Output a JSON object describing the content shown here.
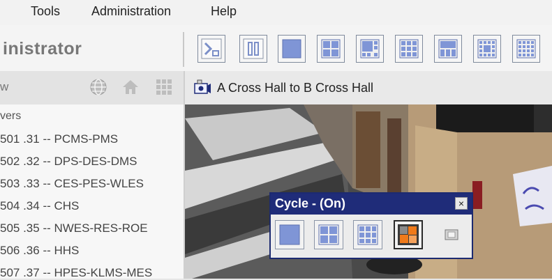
{
  "menu": {
    "items": [
      {
        "label": "Tools"
      },
      {
        "label": "Administration"
      },
      {
        "label": "Help"
      }
    ]
  },
  "app": {
    "title": "inistrator"
  },
  "toolbar": {
    "layout_buttons": [
      {
        "icon": "sequence-icon"
      },
      {
        "icon": "pause-icon"
      },
      {
        "icon": "layout-1x1-icon"
      },
      {
        "icon": "layout-2x2-icon"
      },
      {
        "icon": "layout-1plus5-icon"
      },
      {
        "icon": "layout-3x3-icon"
      },
      {
        "icon": "layout-3x3-alt-icon"
      },
      {
        "icon": "layout-4x4-icon"
      },
      {
        "icon": "layout-4x4-alt-icon"
      }
    ]
  },
  "left_panel": {
    "nav_label": "w",
    "tree_header": "vers",
    "servers": [
      {
        "label": "501 .31 -- PCMS-PMS"
      },
      {
        "label": "502 .32 -- DPS-DES-DMS"
      },
      {
        "label": "503 .33 -- CES-PES-WLES"
      },
      {
        "label": "504 .34 -- CHS"
      },
      {
        "label": "505 .35 -- NWES-RES-ROE"
      },
      {
        "label": "506 .36 -- HHS"
      },
      {
        "label": "507 .37 -- HPES-KLMS-MES"
      }
    ]
  },
  "camera": {
    "name": "A Cross Hall to B Cross Hall"
  },
  "cycle_window": {
    "title": "Cycle -  (On)",
    "close_label": "×"
  },
  "colors": {
    "title_bar": "#1f2c79",
    "button_fill": "#7f95d6",
    "active_orange": "#f07a1a"
  }
}
